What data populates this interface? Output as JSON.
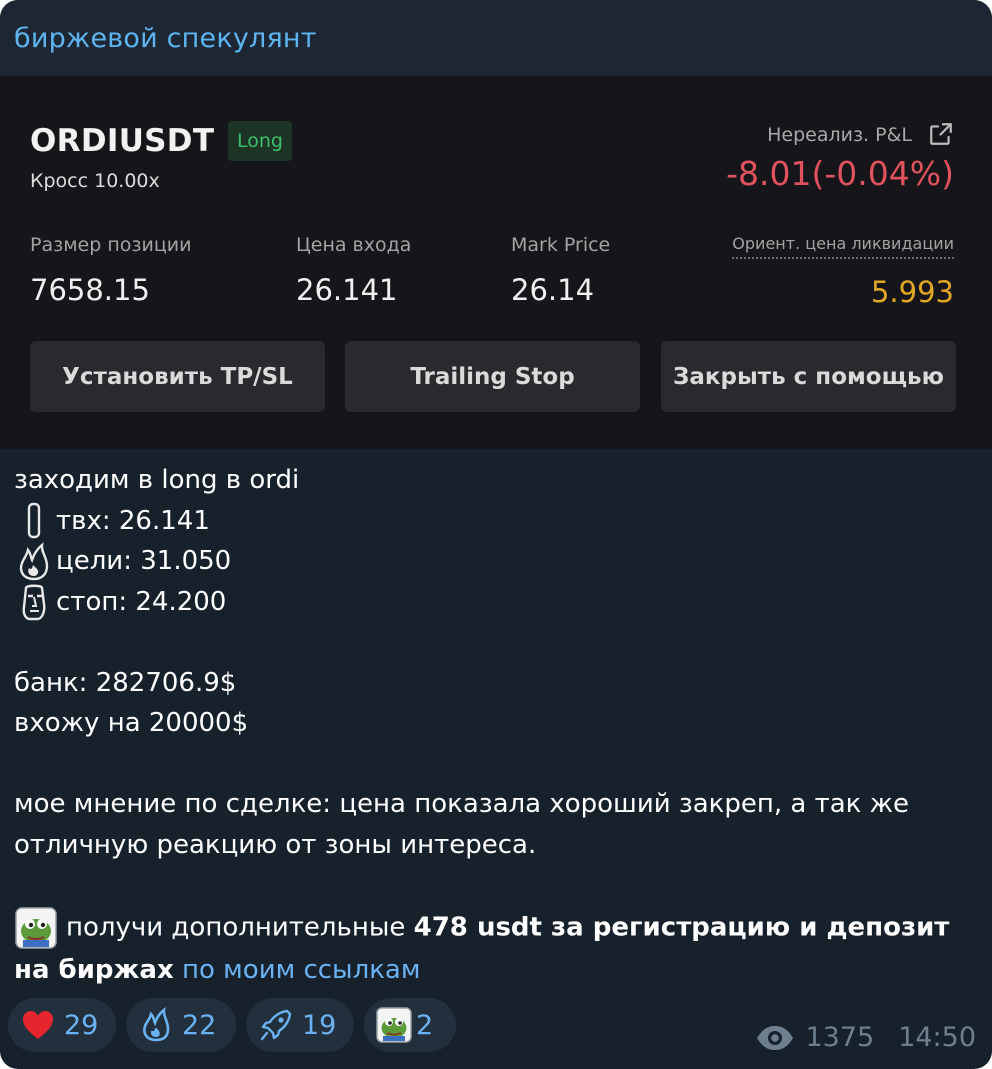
{
  "header": {
    "channel_name": "биржевой спекулянт"
  },
  "position_card": {
    "symbol": "ORDIUSDT",
    "side_badge": "Long",
    "margin_mode": "Кросс 10.00x",
    "pnl_label": "Нереализ. P&L",
    "pnl_value": "-8.01(-0.04%)",
    "stats": [
      {
        "label": "Размер позиции",
        "value": "7658.15"
      },
      {
        "label": "Цена входа",
        "value": "26.141"
      },
      {
        "label": "Mark Price",
        "value": "26.14"
      }
    ],
    "liquidation": {
      "label": "Ориент. цена ликвидации",
      "value": "5.993"
    },
    "buttons": [
      {
        "label": "Установить TP/SL"
      },
      {
        "label": "Trailing Stop"
      },
      {
        "label": "Закрыть с помощью"
      }
    ],
    "colors": {
      "long": "#3bbf6b",
      "pnl_negative": "#e0525e",
      "liquidation": "#e2a623"
    }
  },
  "message": {
    "line1": "заходим в long в ordi",
    "entry": "твх: 26.141",
    "targets": "цели: 31.050",
    "stop": "стоп: 24.200",
    "bank": "банк: 282706.9$",
    "entering": "вхожу на 20000$",
    "opinion": "мое мнение по сделке: цена показала хороший закреп, а так же отличную реакцию от зоны интереса.",
    "promo_prefix": "получи дополнительные",
    "promo_bold": "478 usdt за регистрацию и депозит на биржах",
    "promo_link": "по моим ссылкам",
    "icons": [
      "candle-icon",
      "fire-icon",
      "moai-icon",
      "pepe-sticker-icon"
    ]
  },
  "reactions": [
    {
      "icon": "heart-icon",
      "count": "29"
    },
    {
      "icon": "fire-icon",
      "count": "22"
    },
    {
      "icon": "rocket-icon",
      "count": "19"
    },
    {
      "icon": "pepe-sticker-icon",
      "count": "2"
    }
  ],
  "meta": {
    "views": "1375",
    "time": "14:50"
  }
}
